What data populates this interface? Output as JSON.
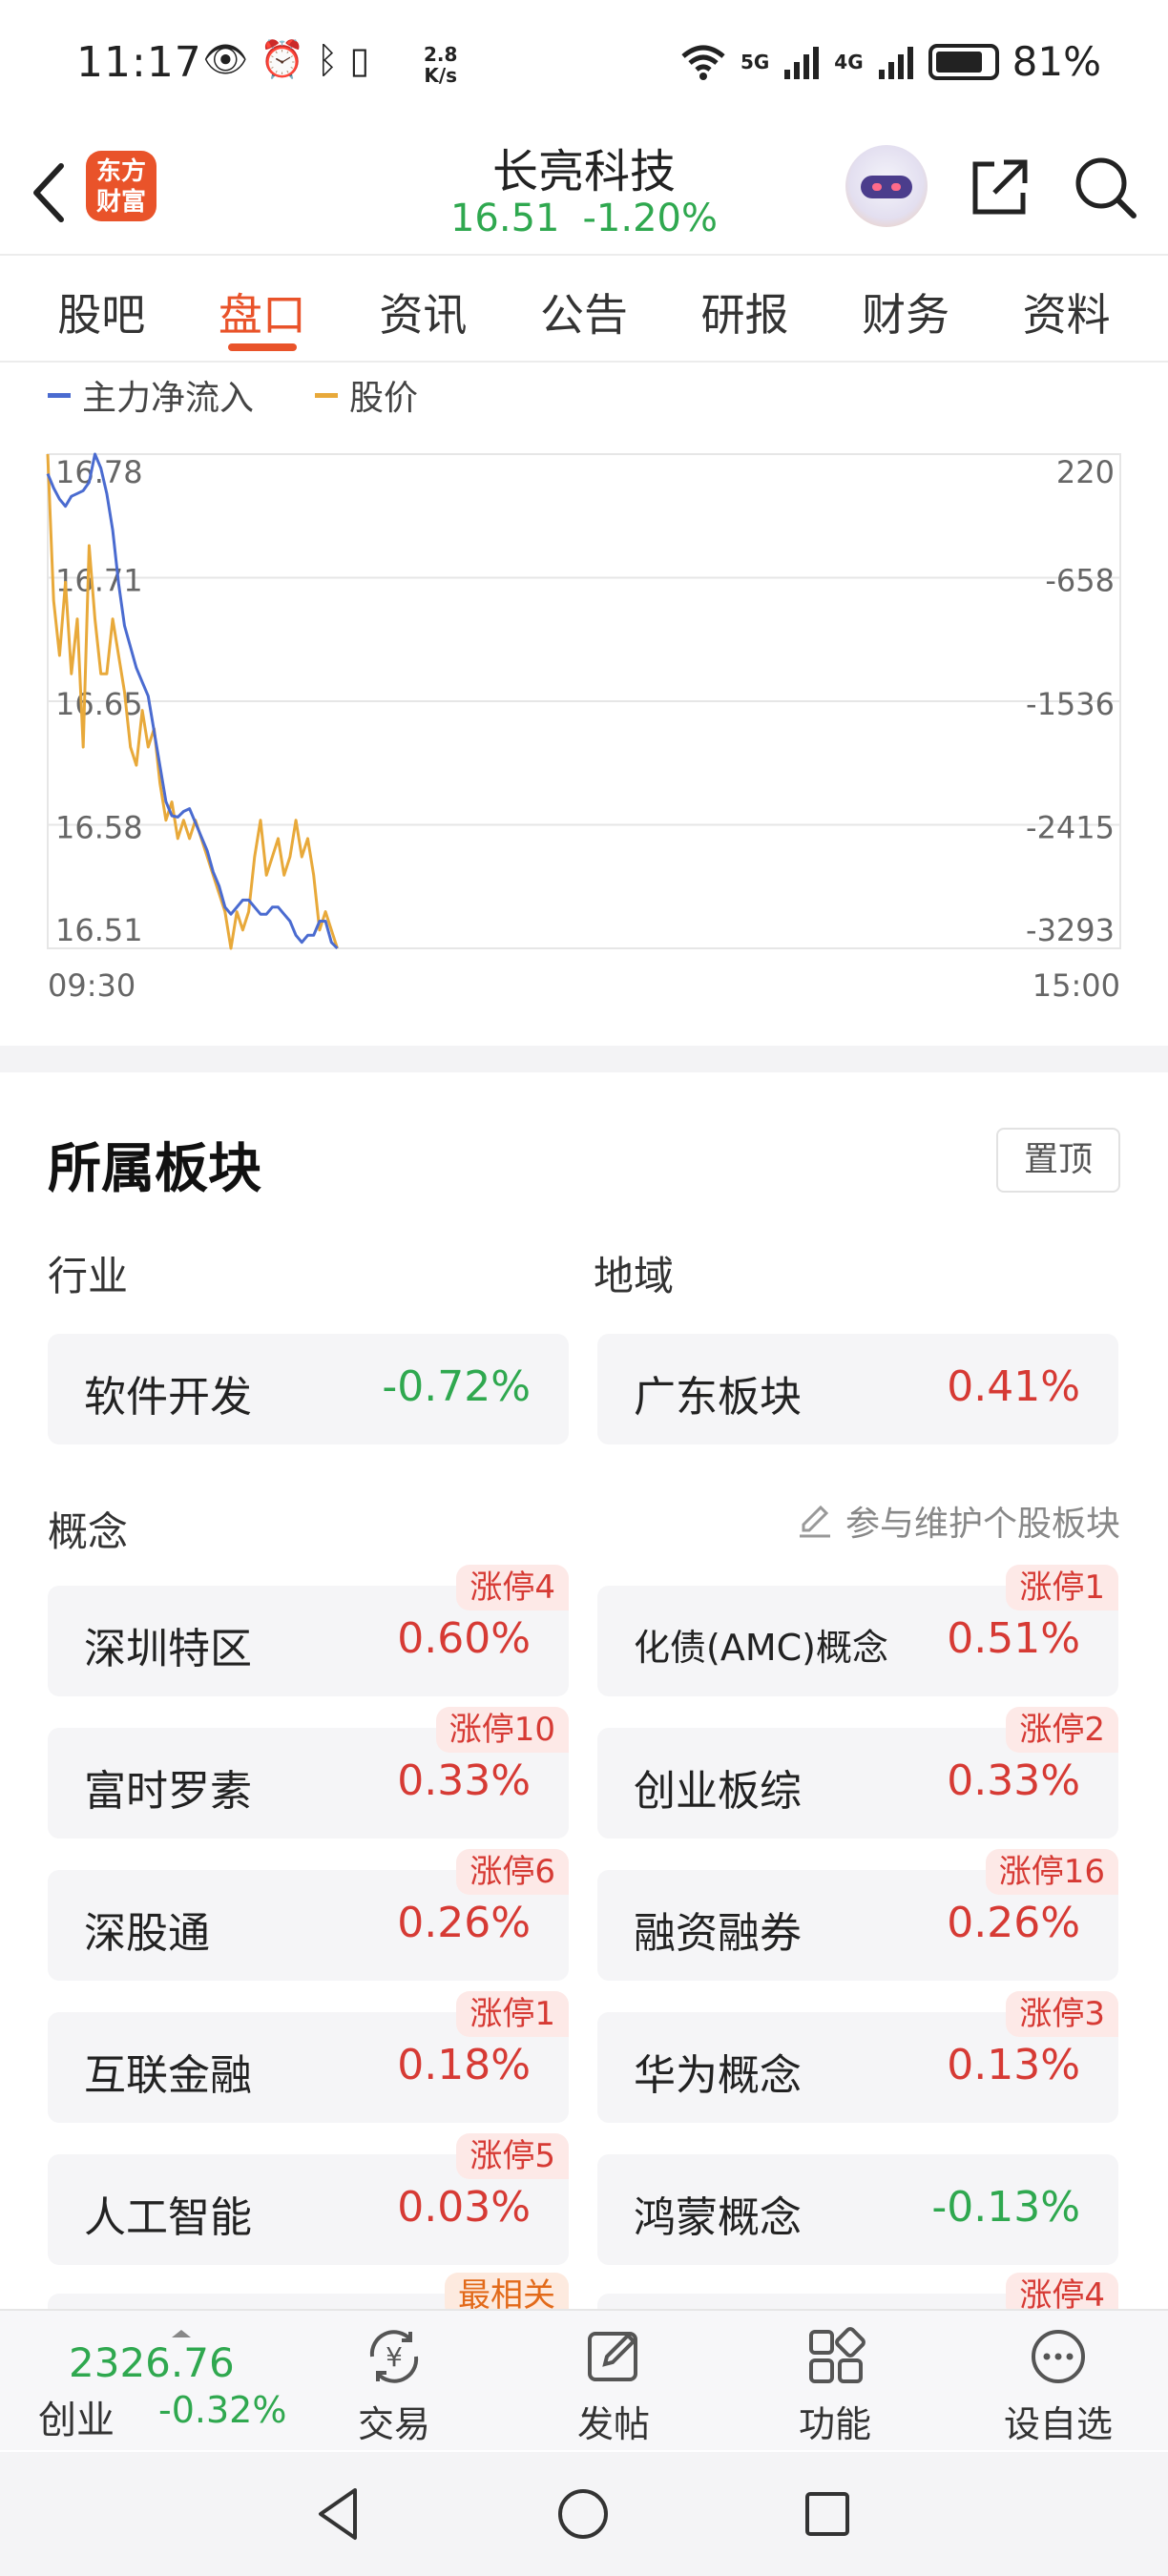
{
  "status_bar": {
    "time": "11:17",
    "net_speed_value": "2.8",
    "net_speed_unit": "K/s",
    "signal_1": "5G",
    "signal_2": "4G",
    "battery": "81%"
  },
  "header": {
    "logo_text_1": "东方",
    "logo_text_2": "财富",
    "title": "长亮科技",
    "price": "16.51",
    "change": "-1.20%",
    "icons": [
      "back-icon",
      "assistant-bot-icon",
      "share-icon",
      "search-icon"
    ]
  },
  "tabs": [
    {
      "label": "股吧",
      "active": false
    },
    {
      "label": "盘口",
      "active": true
    },
    {
      "label": "资讯",
      "active": false
    },
    {
      "label": "公告",
      "active": false
    },
    {
      "label": "研报",
      "active": false
    },
    {
      "label": "财务",
      "active": false
    },
    {
      "label": "资料",
      "active": false
    }
  ],
  "chart_data": {
    "type": "line",
    "legend": [
      {
        "name": "主力净流入",
        "color": "#4a6bd0"
      },
      {
        "name": "股价",
        "color": "#e8a93a"
      }
    ],
    "y_left_ticks": [
      "16.78",
      "16.71",
      "16.65",
      "16.58",
      "16.51"
    ],
    "y_right_ticks": [
      "220",
      "-658",
      "-1536",
      "-2415",
      "-3293"
    ],
    "y_left_range": [
      16.51,
      16.78
    ],
    "y_right_range": [
      -3293,
      220
    ],
    "x_labels": [
      "09:30",
      "15:00"
    ],
    "series": [
      {
        "name": "主力净流入",
        "color": "#4a6bd0",
        "values": [
          80,
          -20,
          -100,
          -150,
          -80,
          -60,
          -40,
          20,
          220,
          120,
          -60,
          -320,
          -700,
          -1000,
          -1150,
          -1300,
          -1400,
          -1500,
          -1750,
          -2000,
          -2250,
          -2350,
          -2360,
          -2320,
          -2300,
          -2400,
          -2500,
          -2600,
          -2750,
          -2850,
          -3000,
          -3050,
          -3000,
          -2950,
          -2950,
          -3000,
          -3050,
          -3050,
          -3000,
          -3000,
          -3050,
          -3100,
          -3200,
          -3250,
          -3200,
          -3200,
          -3100,
          -3100,
          -3250,
          -3293
        ]
      },
      {
        "name": "股价",
        "color": "#e8a93a",
        "values": [
          16.78,
          16.7,
          16.67,
          16.71,
          16.66,
          16.69,
          16.62,
          16.73,
          16.69,
          16.66,
          16.66,
          16.69,
          16.67,
          16.65,
          16.62,
          16.61,
          16.64,
          16.62,
          16.63,
          16.6,
          16.58,
          16.59,
          16.57,
          16.58,
          16.57,
          16.58,
          16.57,
          16.56,
          16.55,
          16.54,
          16.53,
          16.51,
          16.53,
          16.52,
          16.53,
          16.56,
          16.58,
          16.55,
          16.56,
          16.57,
          16.55,
          16.56,
          16.58,
          16.56,
          16.57,
          16.55,
          16.52,
          16.53,
          16.52,
          16.51
        ]
      }
    ]
  },
  "sectors": {
    "title": "所属板块",
    "pin_label": "置顶",
    "industry_label": "行业",
    "region_label": "地域",
    "concept_label": "概念",
    "maintain_label": "参与维护个股板块",
    "industry": {
      "name": "软件开发",
      "pct": "-0.72%",
      "dir": "down"
    },
    "region": {
      "name": "广东板块",
      "pct": "0.41%",
      "dir": "up"
    },
    "concepts": [
      {
        "name": "深圳特区",
        "pct": "0.60%",
        "dir": "up",
        "badge": "涨停4"
      },
      {
        "name": "化债(AMC)概念",
        "pct": "0.51%",
        "dir": "up",
        "badge": "涨停1"
      },
      {
        "name": "富时罗素",
        "pct": "0.33%",
        "dir": "up",
        "badge": "涨停10"
      },
      {
        "name": "创业板综",
        "pct": "0.33%",
        "dir": "up",
        "badge": "涨停2"
      },
      {
        "name": "深股通",
        "pct": "0.26%",
        "dir": "up",
        "badge": "涨停6"
      },
      {
        "name": "融资融券",
        "pct": "0.26%",
        "dir": "up",
        "badge": "涨停16"
      },
      {
        "name": "互联金融",
        "pct": "0.18%",
        "dir": "up",
        "badge": "涨停1"
      },
      {
        "name": "华为概念",
        "pct": "0.13%",
        "dir": "up",
        "badge": "涨停3"
      },
      {
        "name": "人工智能",
        "pct": "0.03%",
        "dir": "up",
        "badge": "涨停5"
      },
      {
        "name": "鸿蒙概念",
        "pct": "-0.13%",
        "dir": "down",
        "badge": ""
      }
    ],
    "next_badges": [
      "最相关",
      "涨停4"
    ]
  },
  "bottom_bar": {
    "index_value": "2326.76",
    "index_name": "创业",
    "index_change": "-0.32%",
    "items": [
      {
        "label": "交易",
        "icon": "trade-yen-icon"
      },
      {
        "label": "发帖",
        "icon": "compose-icon"
      },
      {
        "label": "功能",
        "icon": "apps-grid-icon"
      },
      {
        "label": "设自选",
        "icon": "more-dots-icon"
      }
    ]
  },
  "colors": {
    "accent": "#e9532a",
    "up": "#d63a34",
    "down": "#2fa84f",
    "flow_line": "#4a6bd0",
    "price_line": "#e8a93a"
  }
}
